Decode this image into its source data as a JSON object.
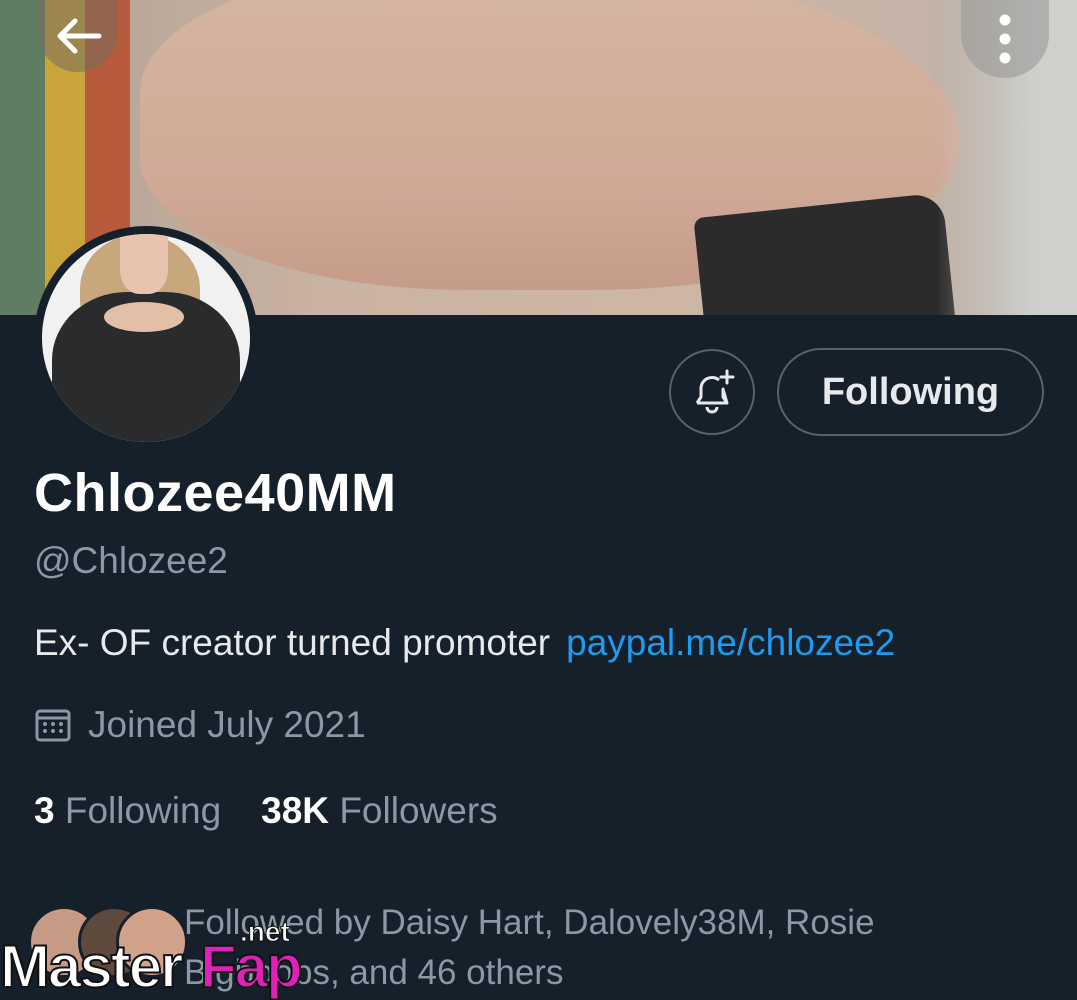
{
  "header": {
    "back_icon": "arrow-left-icon",
    "more_icon": "vertical-dots-icon"
  },
  "profile": {
    "display_name": "Chlozee40MM",
    "handle": "@Chlozee2",
    "bio_text": "Ex- OF creator turned promoter",
    "bio_link": "paypal.me/chlozee2",
    "joined": "Joined July 2021",
    "following_count": "3",
    "following_label": "Following",
    "followers_count": "38K",
    "followers_label": "Followers",
    "followed_by_line1": "Followed by Daisy Hart, Dalovely38M, Rosie",
    "followed_by_line2": "Bigboobs, and 46 others"
  },
  "actions": {
    "notify_icon": "bell-plus-icon",
    "follow_label": "Following"
  },
  "watermark": {
    "part1": "Master",
    "part2": "Fap",
    "part3": ".net"
  },
  "colors": {
    "background": "#15202b",
    "link": "#1d9bf0",
    "secondary_text": "#8b98a5",
    "watermark_accent": "#e020b8"
  }
}
